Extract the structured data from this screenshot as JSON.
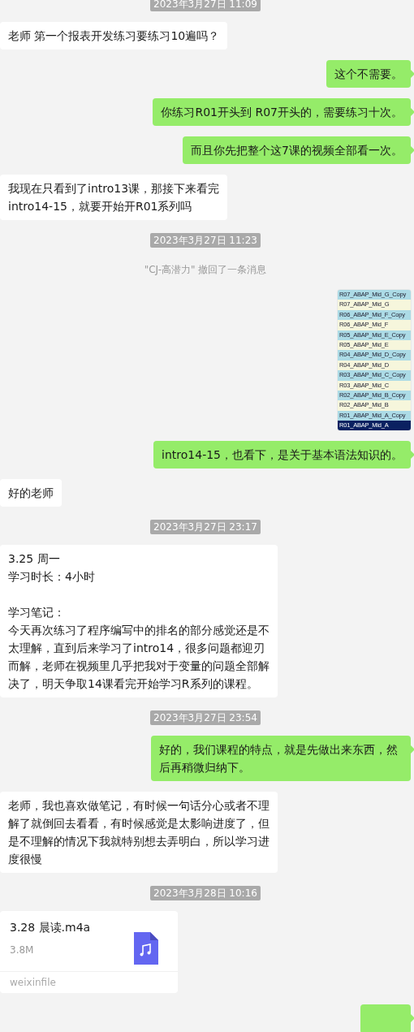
{
  "messages": [
    {
      "kind": "time",
      "text": "2023年3月27日 11:09"
    },
    {
      "kind": "in",
      "text": "老师 第一个报表开发练习要练习10遍吗？"
    },
    {
      "kind": "out",
      "text": "这个不需要。"
    },
    {
      "kind": "out",
      "text": "你练习R01开头到 R07开头的，需要练习十次。"
    },
    {
      "kind": "out",
      "text": "而且你先把整个这7课的视频全部看一次。"
    },
    {
      "kind": "in_lines",
      "paragraphs": [
        [
          "我现在只看到了intro13课，那接下来看完",
          "intro14-15，就要开始开R01系列吗"
        ]
      ]
    },
    {
      "kind": "time",
      "text": "2023年3月27日 11:23"
    },
    {
      "kind": "recall",
      "text": "\"CJ-高潜力\" 撤回了一条消息"
    },
    {
      "kind": "image",
      "items": [
        {
          "text": "R07_ABAP_Mid_G_Copy",
          "selected": false
        },
        {
          "text": "R07_ABAP_Mid_G",
          "selected": false
        },
        {
          "text": "R06_ABAP_Mid_F_Copy",
          "selected": false
        },
        {
          "text": "R06_ABAP_Mid_F",
          "selected": false
        },
        {
          "text": "R05_ABAP_Mid_E_Copy",
          "selected": false
        },
        {
          "text": "R05_ABAP_Mid_E",
          "selected": false
        },
        {
          "text": "R04_ABAP_Mid_D_Copy",
          "selected": false
        },
        {
          "text": "R04_ABAP_Mid_D",
          "selected": false
        },
        {
          "text": "R03_ABAP_Mid_C_Copy",
          "selected": false
        },
        {
          "text": "R03_ABAP_Mid_C",
          "selected": false
        },
        {
          "text": "R02_ABAP_Mid_B_Copy",
          "selected": false
        },
        {
          "text": "R02_ABAP_Mid_B",
          "selected": false
        },
        {
          "text": "R01_ABAP_Mid_A_Copy",
          "selected": false
        },
        {
          "text": "R01_ABAP_Mid_A",
          "selected": true
        }
      ]
    },
    {
      "kind": "out",
      "text": "intro14-15，也看下，是关于基本语法知识的。"
    },
    {
      "kind": "in",
      "text": "好的老师"
    },
    {
      "kind": "time",
      "text": "2023年3月27日 23:17"
    },
    {
      "kind": "in_lines",
      "paragraphs": [
        [
          "3.25 周一",
          "学习时长：4小时"
        ],
        [
          "学习笔记：",
          "今天再次练习了程序编写中的排名的部分感觉还是不太理解，直到后来学习了intro14，很多问题都迎刃而解，老师在视频里几乎把我对于变量的问题全部解决了，明天争取14课看完开始学习R系列的课程。"
        ]
      ]
    },
    {
      "kind": "time",
      "text": "2023年3月27日 23:54"
    },
    {
      "kind": "out",
      "text": "好的，我们课程的特点，就是先做出来东西，然后再稍微归纳下。"
    },
    {
      "kind": "in",
      "text": "老师，我也喜欢做笔记，有时候一句话分心或者不理解了就倒回去看看，有时候感觉是太影响进度了，但是不理解的情况下我就特别想去弄明白，所以学习进度很慢"
    },
    {
      "kind": "time",
      "text": "2023年3月28日 10:16"
    },
    {
      "kind": "file",
      "name": "3.28 晨读.m4a",
      "size": "3.8M",
      "source": "weixinfile"
    },
    {
      "kind": "out_hidden"
    }
  ]
}
